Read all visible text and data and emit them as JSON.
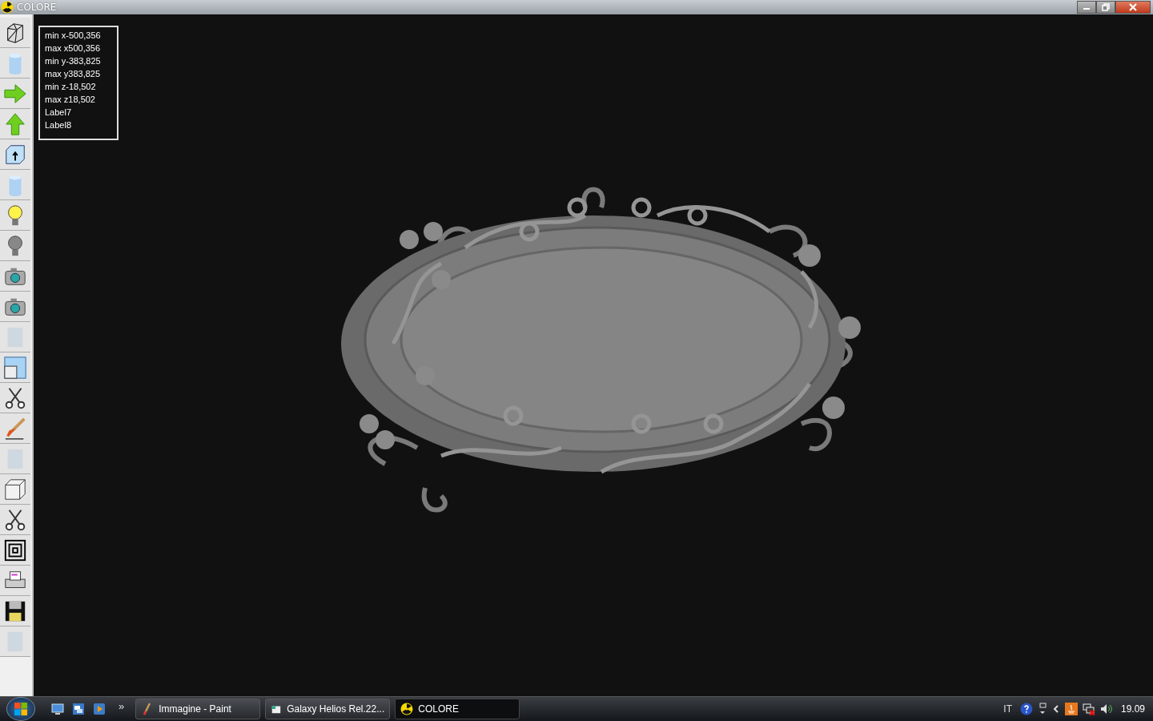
{
  "window": {
    "title": "COLORE"
  },
  "toolbar": [
    {
      "kind": "wireframe"
    },
    {
      "kind": "cylinder"
    },
    {
      "kind": "arrow-right"
    },
    {
      "kind": "arrow-up"
    },
    {
      "kind": "box-arrow"
    },
    {
      "kind": "cylinder"
    },
    {
      "kind": "bulb-on"
    },
    {
      "kind": "bulb-off"
    },
    {
      "kind": "camera"
    },
    {
      "kind": "camera"
    },
    {
      "kind": "blank"
    },
    {
      "kind": "window"
    },
    {
      "kind": "scissors"
    },
    {
      "kind": "brush"
    },
    {
      "kind": "blank"
    },
    {
      "kind": "cube"
    },
    {
      "kind": "scissors"
    },
    {
      "kind": "squares"
    },
    {
      "kind": "printer"
    },
    {
      "kind": "floppy"
    },
    {
      "kind": "blank"
    }
  ],
  "info_labels": [
    "min x-500,356",
    "max x500,356",
    "min y-383,825",
    "max y383,825",
    "min z-18,502",
    "max z18,502",
    "Label7",
    "Label8"
  ],
  "taskbar": {
    "overflow": "»",
    "tasks": [
      {
        "label": "Immagine - Paint",
        "kind": "paint",
        "selected": false
      },
      {
        "label": "Galaxy Helios  Rel.22...",
        "kind": "app",
        "selected": false
      },
      {
        "label": "COLORE",
        "kind": "radiation",
        "selected": true
      }
    ],
    "language": "IT",
    "clock": "19.09"
  }
}
